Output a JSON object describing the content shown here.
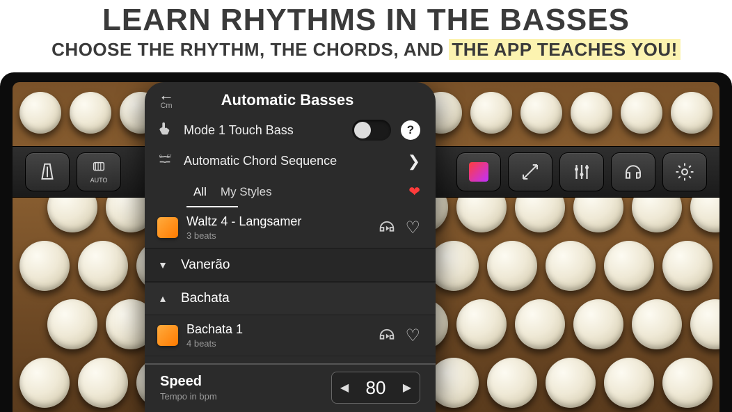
{
  "promo": {
    "headline": "LEARN RHYTHMS IN THE BASSES",
    "sub_pre": "CHOOSE THE RHYTHM, THE CHORDS, AND ",
    "sub_hl": "THE APP TEACHES YOU!"
  },
  "panel": {
    "back_sub": "Cm",
    "title": "Automatic Basses",
    "mode_touch_label": "Mode 1 Touch Bass",
    "auto_seq_label": "Automatic Chord Sequence",
    "tabs": {
      "all": "All",
      "my_styles": "My Styles"
    },
    "styles": [
      {
        "title": "Waltz 4 - Langsamer",
        "sub": "3 beats"
      }
    ],
    "groups": {
      "vanerao": "Vanerão",
      "bachata": "Bachata"
    },
    "bachata_items": [
      {
        "title": "Bachata 1",
        "sub": "4 beats"
      }
    ],
    "speed": {
      "label": "Speed",
      "sub": "Tempo in bpm",
      "value": "80"
    }
  },
  "toolbar": {
    "auto_label": "AUTO"
  }
}
